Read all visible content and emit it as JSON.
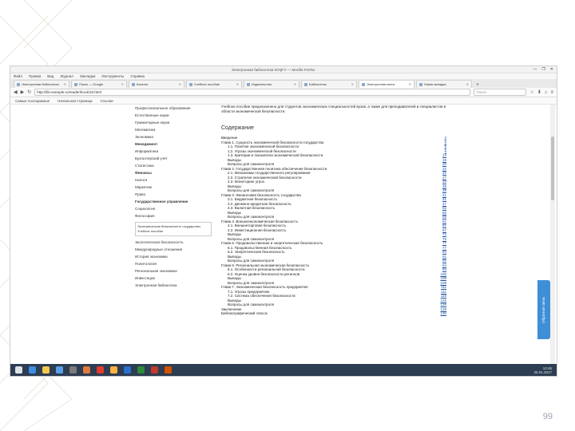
{
  "slide": {
    "number": "99"
  },
  "window": {
    "title": "Электронная библиотека ЮУрГУ — Mozilla Firefox",
    "controls": [
      "—",
      "❐",
      "✕"
    ]
  },
  "menubar": [
    "Файл",
    "Правка",
    "Вид",
    "Журнал",
    "Закладки",
    "Инструменты",
    "Справка"
  ],
  "tabs": [
    {
      "label": "Электронная библиотека",
      "active": false
    },
    {
      "label": "Поиск — Google",
      "active": false
    },
    {
      "label": "Каталог",
      "active": false
    },
    {
      "label": "Учебное пособие",
      "active": false
    },
    {
      "label": "Издательство",
      "active": false
    },
    {
      "label": "Библиотека",
      "active": false
    },
    {
      "label": "Электронная книга",
      "active": true
    },
    {
      "label": "Новая вкладка",
      "active": false
    }
  ],
  "navbar": {
    "url": "http://lib.example.ru/reader/book/10.html",
    "search_placeholder": "Поиск"
  },
  "bookmarks": [
    "Самые посещаемые",
    "Начальная страница",
    "Ссылки"
  ],
  "sidebar": {
    "items": [
      {
        "label": "Профессиональное образование",
        "bold": false
      },
      {
        "label": "Естественные науки",
        "bold": false
      },
      {
        "label": "Гуманитарные науки",
        "bold": false
      },
      {
        "label": "Математика",
        "bold": false
      },
      {
        "label": "Экономика",
        "bold": false
      },
      {
        "label": "Менеджмент",
        "bold": true
      },
      {
        "label": "Информатика",
        "bold": false
      },
      {
        "label": "Бухгалтерский учёт",
        "bold": false
      },
      {
        "label": "Статистика",
        "bold": false
      },
      {
        "label": "Финансы",
        "bold": true
      },
      {
        "label": "Налоги",
        "bold": false
      },
      {
        "label": "Маркетинг",
        "bold": false
      },
      {
        "label": "Право",
        "bold": false
      },
      {
        "label": "Государственное управление",
        "bold": true
      },
      {
        "label": "Социология",
        "bold": false
      },
      {
        "label": "Философия",
        "bold": false
      }
    ],
    "card_text": "Экономическая безопасность государства. Учебное пособие",
    "items_after": [
      {
        "label": "Экологическая безопасность",
        "bold": false
      },
      {
        "label": "Международные отношения",
        "bold": false
      },
      {
        "label": "История экономики",
        "bold": false
      },
      {
        "label": "Политология",
        "bold": false
      },
      {
        "label": "Региональная экономика",
        "bold": false
      },
      {
        "label": "Инвестиции",
        "bold": false
      }
    ],
    "footer": "Электронная библиотека"
  },
  "document": {
    "intro": "Учебное пособие предназначено для студентов экономических специальностей вузов, а также для преподавателей и специалистов в области экономической безопасности.",
    "toc_heading": "Содержание",
    "toc": [
      {
        "title": "Введение",
        "page": "3",
        "level": 0
      },
      {
        "title": "Глава 1. Сущность экономической безопасности государства",
        "page": "5",
        "level": 0
      },
      {
        "title": "1.1. Понятие экономической безопасности",
        "page": "5",
        "level": 1
      },
      {
        "title": "1.2. Угрозы экономической безопасности",
        "page": "9",
        "level": 1
      },
      {
        "title": "1.3. Критерии и показатели экономической безопасности",
        "page": "14",
        "level": 1
      },
      {
        "title": "Выводы",
        "page": "19",
        "level": 1
      },
      {
        "title": "Вопросы для самоконтроля",
        "page": "20",
        "level": 1
      },
      {
        "title": "Глава 2. Государственная политика обеспечения безопасности",
        "page": "22",
        "level": 0
      },
      {
        "title": "2.1. Механизмы государственного регулирования",
        "page": "22",
        "level": 1
      },
      {
        "title": "2.2. Стратегия экономической безопасности",
        "page": "27",
        "level": 1
      },
      {
        "title": "2.3. Мониторинг угроз",
        "page": "33",
        "level": 1
      },
      {
        "title": "Выводы",
        "page": "38",
        "level": 1
      },
      {
        "title": "Вопросы для самоконтроля",
        "page": "39",
        "level": 1
      },
      {
        "title": "Глава 3. Финансовая безопасность государства",
        "page": "41",
        "level": 0
      },
      {
        "title": "3.1. Бюджетная безопасность",
        "page": "41",
        "level": 1
      },
      {
        "title": "3.2. Денежно-кредитная безопасность",
        "page": "47",
        "level": 1
      },
      {
        "title": "3.3. Валютная безопасность",
        "page": "52",
        "level": 1
      },
      {
        "title": "Выводы",
        "page": "58",
        "level": 1
      },
      {
        "title": "Вопросы для самоконтроля",
        "page": "59",
        "level": 1
      },
      {
        "title": "Глава 4. Внешнеэкономическая безопасность",
        "page": "61",
        "level": 0
      },
      {
        "title": "4.1. Внешнеторговая безопасность",
        "page": "61",
        "level": 1
      },
      {
        "title": "4.2. Инвестиционная безопасность",
        "page": "67",
        "level": 1
      },
      {
        "title": "Выводы",
        "page": "74",
        "level": 1
      },
      {
        "title": "Вопросы для самоконтроля",
        "page": "75",
        "level": 1
      },
      {
        "title": "Глава 5. Продовольственная и энергетическая безопасность",
        "page": "77",
        "level": 0
      },
      {
        "title": "5.1. Продовольственная безопасность",
        "page": "77",
        "level": 1
      },
      {
        "title": "5.2. Энергетическая безопасность",
        "page": "84",
        "level": 1
      },
      {
        "title": "Выводы",
        "page": "91",
        "level": 1
      },
      {
        "title": "Вопросы для самоконтроля",
        "page": "92",
        "level": 1
      },
      {
        "title": "Глава 6. Региональная экономическая безопасность",
        "page": "94",
        "level": 0
      },
      {
        "title": "6.1. Особенности региональной безопасности",
        "page": "94",
        "level": 1
      },
      {
        "title": "6.2. Оценка уровня безопасности регионов",
        "page": "100",
        "level": 1
      },
      {
        "title": "Выводы",
        "page": "108",
        "level": 1
      },
      {
        "title": "Вопросы для самоконтроля",
        "page": "109",
        "level": 1
      },
      {
        "title": "Глава 7. Экономическая безопасность предприятия",
        "page": "111",
        "level": 0
      },
      {
        "title": "7.1. Угрозы предприятию",
        "page": "111",
        "level": 1
      },
      {
        "title": "7.2. Система обеспечения безопасности",
        "page": "118",
        "level": 1
      },
      {
        "title": "Выводы",
        "page": "125",
        "level": 1
      },
      {
        "title": "Вопросы для самоконтроля",
        "page": "126",
        "level": 1
      },
      {
        "title": "Заключение",
        "page": "128",
        "level": 0
      },
      {
        "title": "Библиографический список",
        "page": "130",
        "level": 0
      }
    ]
  },
  "feedback_label": "Обратная связь",
  "taskbar": {
    "icons": [
      "#3c8ee0",
      "#f2c94c",
      "#5aa0e6",
      "#7a7a7a",
      "#e07a3c",
      "#e23b2e",
      "#ffb340",
      "#2b6fd1",
      "#2e8b3a",
      "#c0392b",
      "#d35400"
    ],
    "clock": "12:45",
    "date": "25.01.2017"
  }
}
